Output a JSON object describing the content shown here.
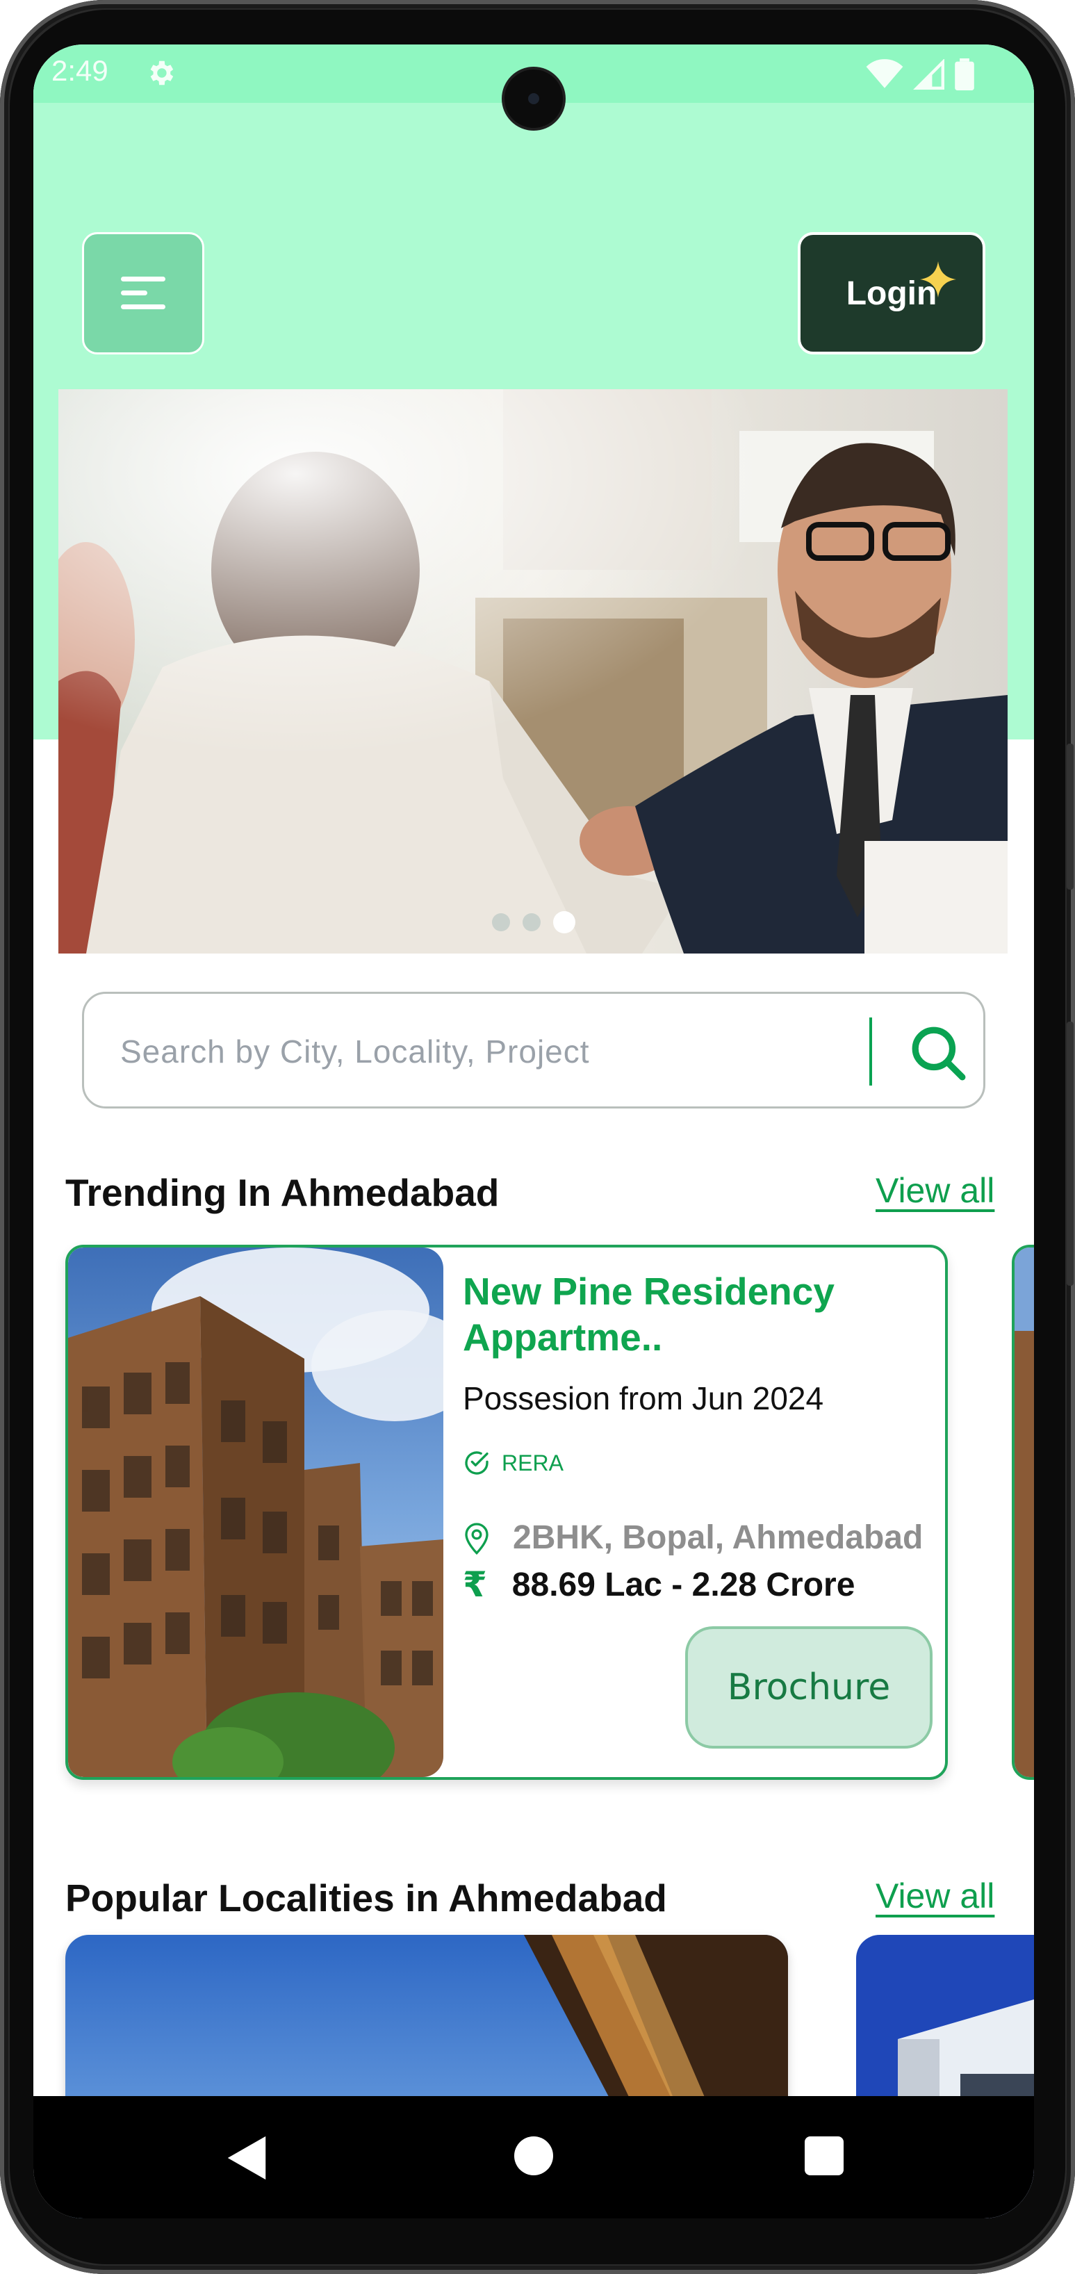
{
  "status_bar": {
    "time": "2:49"
  },
  "header": {
    "menu_icon": "menu-icon",
    "login_label": "Login"
  },
  "hero": {
    "carousel_dots": 3,
    "active_dot": 3
  },
  "search": {
    "placeholder": "Search by City, Locality, Project"
  },
  "trending": {
    "title": "Trending In Ahmedabad",
    "view_all": "View all",
    "card": {
      "title": "New Pine Residency Appartme..",
      "possession": "Possesion from Jun 2024",
      "rera": "RERA",
      "location": "2BHK, Bopal, Ahmedabad",
      "price": "88.69 Lac - 2.28 Crore",
      "currency_symbol": "₹",
      "brochure_label": "Brochure"
    }
  },
  "localities": {
    "title": "Popular Localities in Ahmedabad",
    "view_all": "View all"
  },
  "colors": {
    "accent": "#0e9f4e",
    "header_bg": "#adfbd2",
    "login_bg": "#1e3a2b"
  }
}
